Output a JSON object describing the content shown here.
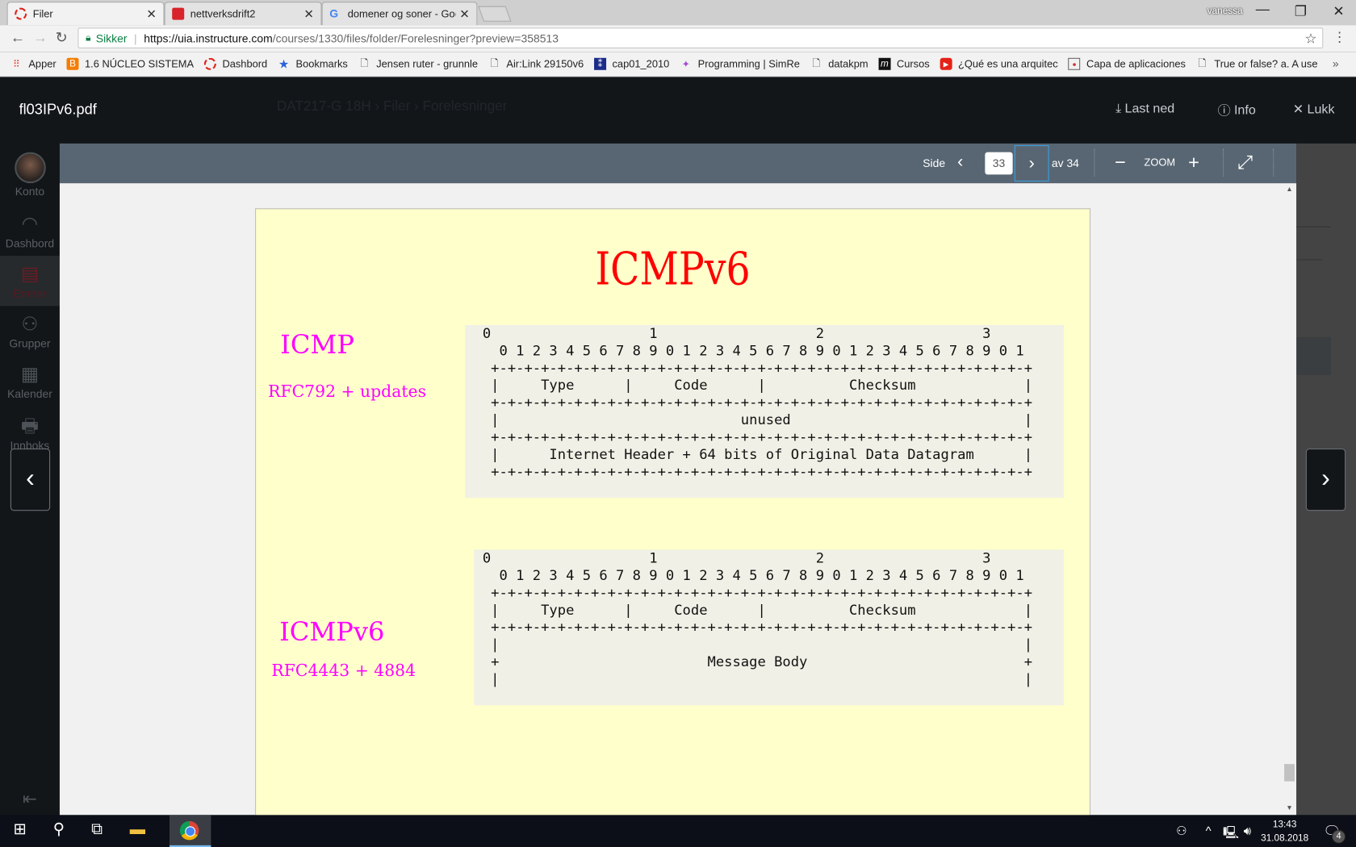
{
  "browser": {
    "tabs": [
      {
        "title": "Filer",
        "icon": "canvas-ring-icon",
        "active": true
      },
      {
        "title": "nettverksdrift2",
        "icon": "pdf-app-icon",
        "active": false
      },
      {
        "title": "domener og soner - Goo",
        "icon": "google-icon",
        "active": false
      }
    ],
    "profile_name": "vanessa",
    "security_label": "Sikker",
    "url_host": "https://uia.instructure.com",
    "url_path": "/courses/1330/files/folder/Forelesninger?preview=358513",
    "bookmarks": [
      {
        "label": "Apper",
        "icon": "apps-grid-icon"
      },
      {
        "label": "1.6 NÚCLEO SISTEMA",
        "icon": "blogger-icon"
      },
      {
        "label": "Dashbord",
        "icon": "canvas-ring-icon"
      },
      {
        "label": "Bookmarks",
        "icon": "star-icon"
      },
      {
        "label": "Jensen ruter - grunnle",
        "icon": "page-icon"
      },
      {
        "label": "Air:Link 29150v6",
        "icon": "page-icon"
      },
      {
        "label": "cap01_2010",
        "icon": "site-icon"
      },
      {
        "label": "Programming | SimRe",
        "icon": "sparkle-icon"
      },
      {
        "label": "datakpm",
        "icon": "page-icon"
      },
      {
        "label": "Cursos",
        "icon": "site-icon"
      },
      {
        "label": "¿Qué es una arquitec",
        "icon": "youtube-icon"
      },
      {
        "label": "Capa de aplicaciones",
        "icon": "presentation-icon"
      },
      {
        "label": "True or false? a. A use",
        "icon": "page-icon"
      }
    ],
    "more_bookmarks": "»"
  },
  "header": {
    "filename": "fl03IPv6.pdf",
    "breadcrumb_ghost": "DAT217-G 18H  ›  Filer  ›  Forelesninger",
    "download_label": "Last ned",
    "info_label": "Info",
    "close_label": "Lukk"
  },
  "leftnav": {
    "items": [
      {
        "label": "Konto",
        "icon": "avatar"
      },
      {
        "label": "Dashbord",
        "icon": "speedometer-icon"
      },
      {
        "label": "Emner",
        "icon": "book-icon",
        "active": true
      },
      {
        "label": "Grupper",
        "icon": "people-icon"
      },
      {
        "label": "Kalender",
        "icon": "calendar-icon"
      },
      {
        "label": "Innboks",
        "icon": "inbox-icon"
      }
    ]
  },
  "toolbar": {
    "page_label": "Side",
    "current_page": "33",
    "total_label": "av 34",
    "zoom_label": "ZOOM"
  },
  "slide": {
    "title": "ICMPv6",
    "icmp_heading": "ICMP",
    "icmp_rfc": "RFC792 + updates",
    "icmpv6_heading": "ICMPv6",
    "icmpv6_rfc": "RFC4443 + 4884",
    "icmp_diagram": [
      "0                   1                   2                   3",
      "  0 1 2 3 4 5 6 7 8 9 0 1 2 3 4 5 6 7 8 9 0 1 2 3 4 5 6 7 8 9 0 1",
      " +-+-+-+-+-+-+-+-+-+-+-+-+-+-+-+-+-+-+-+-+-+-+-+-+-+-+-+-+-+-+-+-+",
      " |     Type      |     Code      |          Checksum             |",
      " +-+-+-+-+-+-+-+-+-+-+-+-+-+-+-+-+-+-+-+-+-+-+-+-+-+-+-+-+-+-+-+-+",
      " |                             unused                            |",
      " +-+-+-+-+-+-+-+-+-+-+-+-+-+-+-+-+-+-+-+-+-+-+-+-+-+-+-+-+-+-+-+-+",
      " |      Internet Header + 64 bits of Original Data Datagram      |",
      " +-+-+-+-+-+-+-+-+-+-+-+-+-+-+-+-+-+-+-+-+-+-+-+-+-+-+-+-+-+-+-+-+"
    ],
    "icmpv6_diagram": [
      "0                   1                   2                   3",
      "  0 1 2 3 4 5 6 7 8 9 0 1 2 3 4 5 6 7 8 9 0 1 2 3 4 5 6 7 8 9 0 1",
      " +-+-+-+-+-+-+-+-+-+-+-+-+-+-+-+-+-+-+-+-+-+-+-+-+-+-+-+-+-+-+-+-+",
      " |     Type      |     Code      |          Checksum             |",
      " +-+-+-+-+-+-+-+-+-+-+-+-+-+-+-+-+-+-+-+-+-+-+-+-+-+-+-+-+-+-+-+-+",
      " |                                                               |",
      " +                         Message Body                          +",
      " |                                                               |"
    ]
  },
  "taskbar": {
    "time": "13:43",
    "date": "31.08.2018",
    "notification_count": "4"
  },
  "colors": {
    "slide_bg": "#ffffcc",
    "title_red": "#ff0000",
    "heading_magenta": "#ff00ff",
    "toolbar_bg": "#586673",
    "canvas_dark": "#121619"
  }
}
